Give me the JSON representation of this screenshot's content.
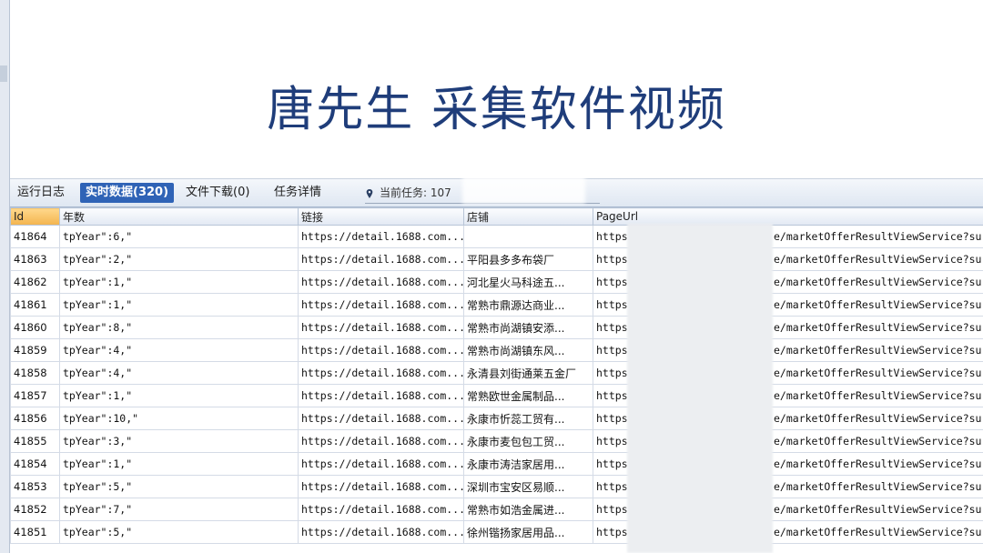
{
  "banner": {
    "title": "唐先生 采集软件视频"
  },
  "tabs": [
    {
      "label": "运行日志",
      "active": false
    },
    {
      "label": "实时数据(320)",
      "active": true
    },
    {
      "label": "文件下载(0)",
      "active": false
    },
    {
      "label": "任务详情",
      "active": false
    }
  ],
  "task": {
    "label": "当前任务: 107",
    "icon": "pin-icon"
  },
  "columns": [
    "Id",
    "年数",
    "链接",
    "店铺",
    "PageUrl"
  ],
  "rows": [
    {
      "id": "41864",
      "year": "tpYear\":6,\"",
      "link": "https://detail.1688.com...",
      "shop": "",
      "url_start": "https",
      "url_end": "e/marketOfferResultViewService?su..."
    },
    {
      "id": "41863",
      "year": "tpYear\":2,\"",
      "link": "https://detail.1688.com...",
      "shop": "平阳县多多布袋厂",
      "url_start": "https",
      "url_end": "e/marketOfferResultViewService?su..."
    },
    {
      "id": "41862",
      "year": "tpYear\":1,\"",
      "link": "https://detail.1688.com...",
      "shop": "河北星火马科途五...",
      "url_start": "https",
      "url_end": "e/marketOfferResultViewService?su..."
    },
    {
      "id": "41861",
      "year": "tpYear\":1,\"",
      "link": "https://detail.1688.com...",
      "shop": "常熟市鼎源达商业...",
      "url_start": "https",
      "url_end": "e/marketOfferResultViewService?su..."
    },
    {
      "id": "41860",
      "year": "tpYear\":8,\"",
      "link": "https://detail.1688.com...",
      "shop": "常熟市尚湖镇安添...",
      "url_start": "https",
      "url_end": "e/marketOfferResultViewService?su..."
    },
    {
      "id": "41859",
      "year": "tpYear\":4,\"",
      "link": "https://detail.1688.com...",
      "shop": "常熟市尚湖镇东风...",
      "url_start": "https",
      "url_end": "e/marketOfferResultViewService?su..."
    },
    {
      "id": "41858",
      "year": "tpYear\":4,\"",
      "link": "https://detail.1688.com...",
      "shop": "永清县刘街通莱五金厂",
      "url_start": "https",
      "url_end": "e/marketOfferResultViewService?su..."
    },
    {
      "id": "41857",
      "year": "tpYear\":1,\"",
      "link": "https://detail.1688.com...",
      "shop": "常熟欧世金属制品...",
      "url_start": "https:",
      "url_end": "e/marketOfferResultViewService?su..."
    },
    {
      "id": "41856",
      "year": "tpYear\":10,\"",
      "link": "https://detail.1688.com...",
      "shop": "永康市忻蕊工贸有...",
      "url_start": "https:",
      "url_end": "e/marketOfferResultViewService?su..."
    },
    {
      "id": "41855",
      "year": "tpYear\":3,\"",
      "link": "https://detail.1688.com...",
      "shop": "永康市麦包包工贸...",
      "url_start": "https:",
      "url_end": "e/marketOfferResultViewService?su..."
    },
    {
      "id": "41854",
      "year": "tpYear\":1,\"",
      "link": "https://detail.1688.com...",
      "shop": "永康市涛洁家居用...",
      "url_start": "https:",
      "url_end": "e/marketOfferResultViewService?su..."
    },
    {
      "id": "41853",
      "year": "tpYear\":5,\"",
      "link": "https://detail.1688.com...",
      "shop": "深圳市宝安区易顺...",
      "url_start": "https:",
      "url_end": "e/marketOfferResultViewService?su..."
    },
    {
      "id": "41852",
      "year": "tpYear\":7,\"",
      "link": "https://detail.1688.com...",
      "shop": "常熟市如浩金属进...",
      "url_start": "https:",
      "url_end": "e/marketOfferResultViewService?su..."
    },
    {
      "id": "41851",
      "year": "tpYear\":5,\"",
      "link": "https://detail.1688.com...",
      "shop": "徐州锴扬家居用品...",
      "url_start": "https:",
      "url_end": "e/marketOfferResultViewService?su..."
    }
  ]
}
